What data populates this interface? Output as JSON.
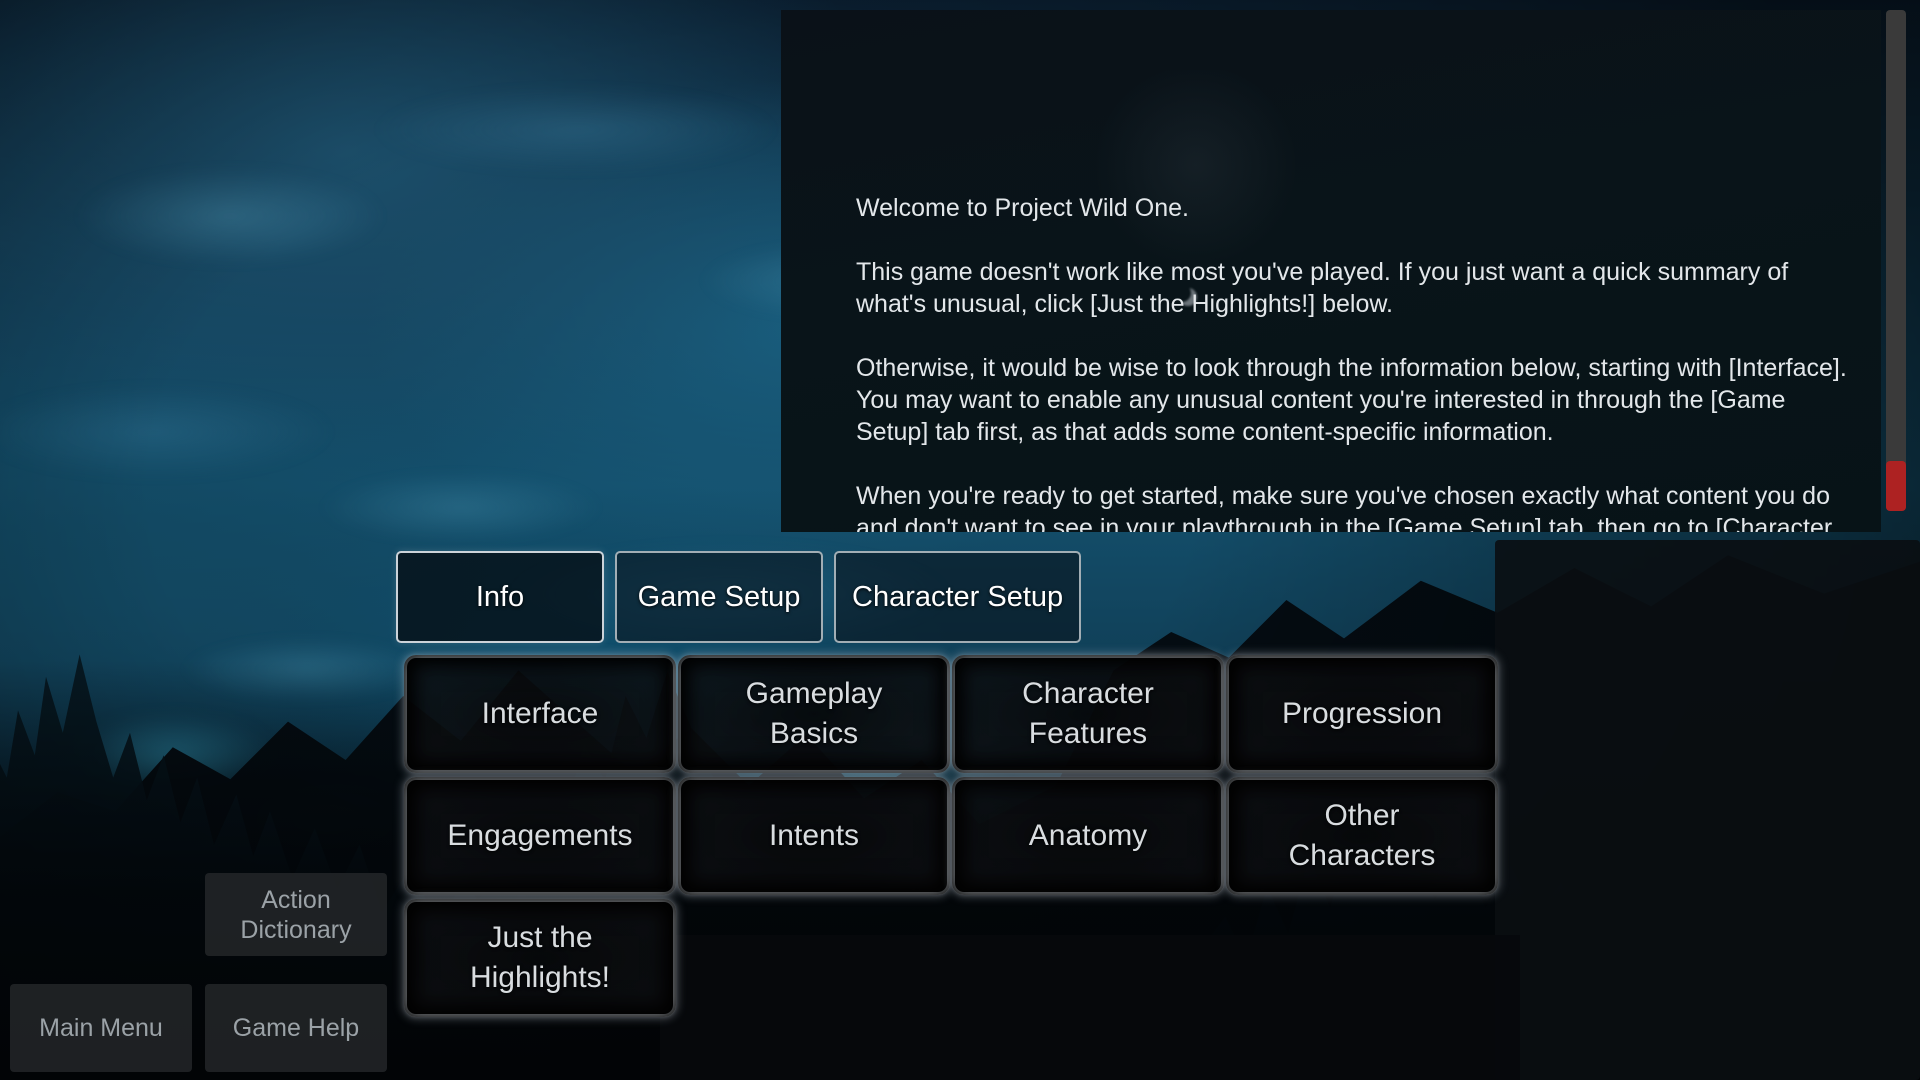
{
  "app": {
    "title": "Project Wild One"
  },
  "info_panel": {
    "paragraphs": [
      "Welcome to Project Wild One.",
      "This game doesn't work like most you've played. If you just want a quick summary of what's unusual, click [Just the Highlights!] below.",
      "Otherwise, it would be wise to look through the information below, starting with [Interface]. You may want to enable any unusual content you're interested in through the [Game Setup] tab first, as that adds some content-specific information.",
      "When you're ready to get started, make sure you've chosen exactly what content you do and don't want to see in your playthrough in the [Game Setup] tab, then go to [Character Setup] to customize your character and start your game. Thank you for playing this prototype."
    ]
  },
  "scrollbar": {
    "name": "vertical-scrollbar",
    "thumb_color": "#ad2222",
    "track_color": "#3a3a3a"
  },
  "tabs": [
    {
      "label": "Info",
      "active": true
    },
    {
      "label": "Game Setup",
      "active": false
    },
    {
      "label": "Character Setup",
      "active": false
    }
  ],
  "topic_buttons": [
    {
      "label": "Interface"
    },
    {
      "label": "Gameplay Basics"
    },
    {
      "label": "Character Features"
    },
    {
      "label": "Progression"
    },
    {
      "label": "Engagements"
    },
    {
      "label": "Intents"
    },
    {
      "label": "Anatomy"
    },
    {
      "label": "Other Characters"
    },
    {
      "label": "Just the Highlights!"
    }
  ],
  "side_buttons": {
    "action_dictionary": "Action Dictionary",
    "main_menu": "Main Menu",
    "game_help": "Game Help"
  },
  "colors": {
    "text_primary": "#e3e7ea",
    "button_text": "#d9dde0",
    "side_button_text": "#9ba2a7",
    "panel_background": "#0a1118",
    "accent_red": "#ad2222"
  }
}
